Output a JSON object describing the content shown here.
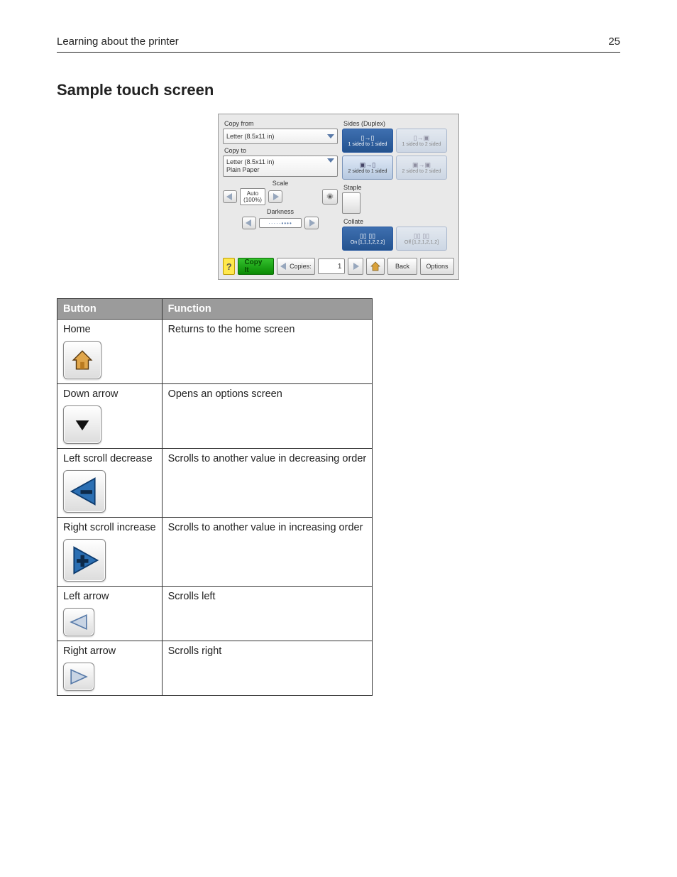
{
  "page_header": {
    "left": "Learning about the printer",
    "right": "25"
  },
  "section_title": "Sample touch screen",
  "touchscreen": {
    "copy_from_label": "Copy from",
    "copy_from_value": "Letter (8.5x11 in)",
    "copy_to_label": "Copy to",
    "copy_to_value": "Letter (8.5x11 in)\nPlain Paper",
    "scale_label": "Scale",
    "scale_value": "Auto\n(100%)",
    "darkness_label": "Darkness",
    "sides_label": "Sides (Duplex)",
    "sides_options": [
      {
        "label": "1 sided to 1 sided",
        "selected": true,
        "disabled": false
      },
      {
        "label": "1 sided to 2 sided",
        "selected": false,
        "disabled": true
      },
      {
        "label": "2 sided to 1 sided",
        "selected": false,
        "disabled": false
      },
      {
        "label": "2 sided to 2 sided",
        "selected": false,
        "disabled": true
      }
    ],
    "staple_label": "Staple",
    "collate_label": "Collate",
    "collate_options": [
      {
        "label": "On [1,1,1,2,2,2]",
        "selected": true
      },
      {
        "label": "Off [1,2,1,2,1,2]",
        "selected": false
      }
    ],
    "copy_it_label": "Copy It",
    "copies_label": "Copies:",
    "copies_value": "1",
    "back_label": "Back",
    "options_label": "Options"
  },
  "table": {
    "head": {
      "button": "Button",
      "function": "Function"
    },
    "rows": [
      {
        "name": "Home",
        "function": "Returns to the home screen",
        "icon": "home"
      },
      {
        "name": "Down arrow",
        "function": "Opens an options screen",
        "icon": "down-arrow"
      },
      {
        "name": "Left scroll decrease",
        "function": "Scrolls to another value in decreasing order",
        "icon": "left-scroll-decrease"
      },
      {
        "name": "Right scroll increase",
        "function": "Scrolls to another value in increasing order",
        "icon": "right-scroll-increase"
      },
      {
        "name": "Left arrow",
        "function": "Scrolls left",
        "icon": "left-arrow"
      },
      {
        "name": "Right arrow",
        "function": "Scrolls right",
        "icon": "right-arrow"
      }
    ]
  }
}
